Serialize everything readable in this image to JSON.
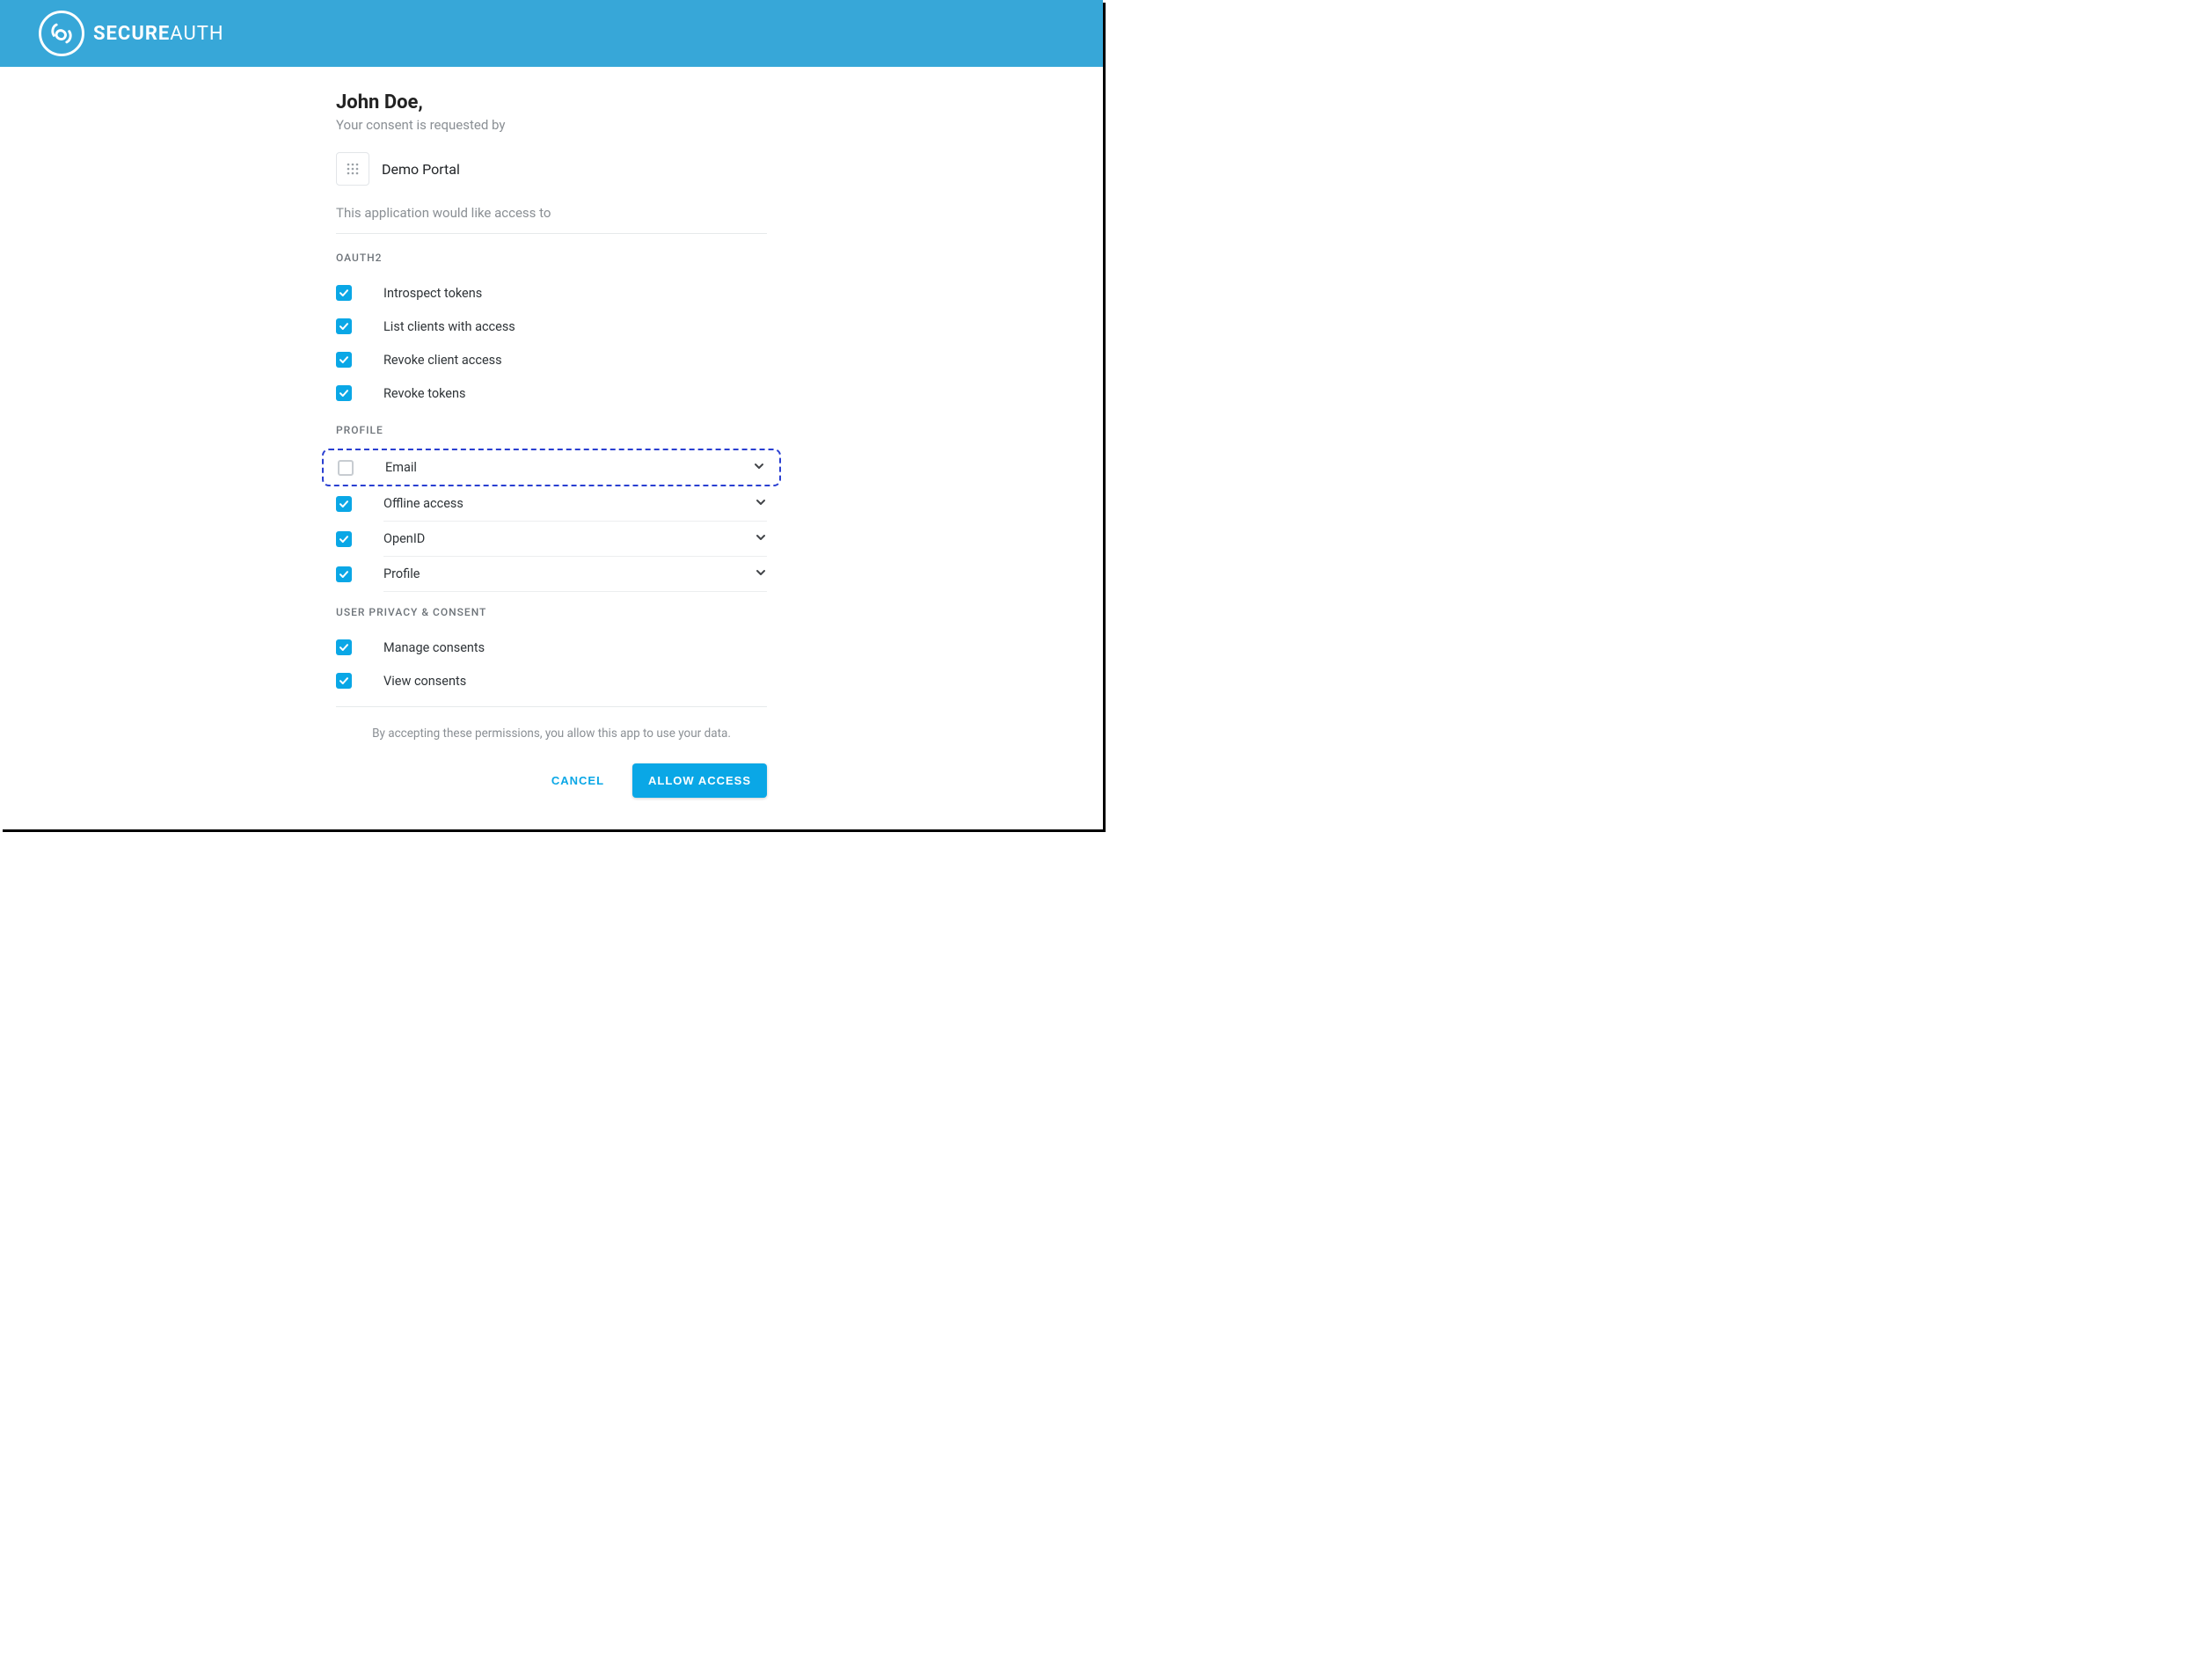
{
  "brand": {
    "name_part1": "SECURE",
    "name_part2": "AUTH"
  },
  "greeting": {
    "user_name": "John Doe,",
    "subtitle": "Your consent is requested by"
  },
  "app": {
    "name": "Demo Portal",
    "access_text": "This application would like access to"
  },
  "sections": [
    {
      "title": "OAUTH2",
      "scopes": [
        {
          "label": "Introspect tokens",
          "checked": true,
          "expandable": false,
          "highlighted": false
        },
        {
          "label": "List clients with access",
          "checked": true,
          "expandable": false,
          "highlighted": false
        },
        {
          "label": "Revoke client access",
          "checked": true,
          "expandable": false,
          "highlighted": false
        },
        {
          "label": "Revoke tokens",
          "checked": true,
          "expandable": false,
          "highlighted": false
        }
      ]
    },
    {
      "title": "PROFILE",
      "scopes": [
        {
          "label": "Email",
          "checked": false,
          "expandable": true,
          "highlighted": true
        },
        {
          "label": "Offline access",
          "checked": true,
          "expandable": true,
          "highlighted": false
        },
        {
          "label": "OpenID",
          "checked": true,
          "expandable": true,
          "highlighted": false
        },
        {
          "label": "Profile",
          "checked": true,
          "expandable": true,
          "highlighted": false
        }
      ]
    },
    {
      "title": "USER PRIVACY & CONSENT",
      "scopes": [
        {
          "label": "Manage consents",
          "checked": true,
          "expandable": false,
          "highlighted": false
        },
        {
          "label": "View consents",
          "checked": true,
          "expandable": false,
          "highlighted": false
        }
      ]
    }
  ],
  "footer": {
    "accept_text": "By accepting these permissions, you allow this app to use your data.",
    "cancel_label": "CANCEL",
    "allow_label": "ALLOW ACCESS"
  }
}
